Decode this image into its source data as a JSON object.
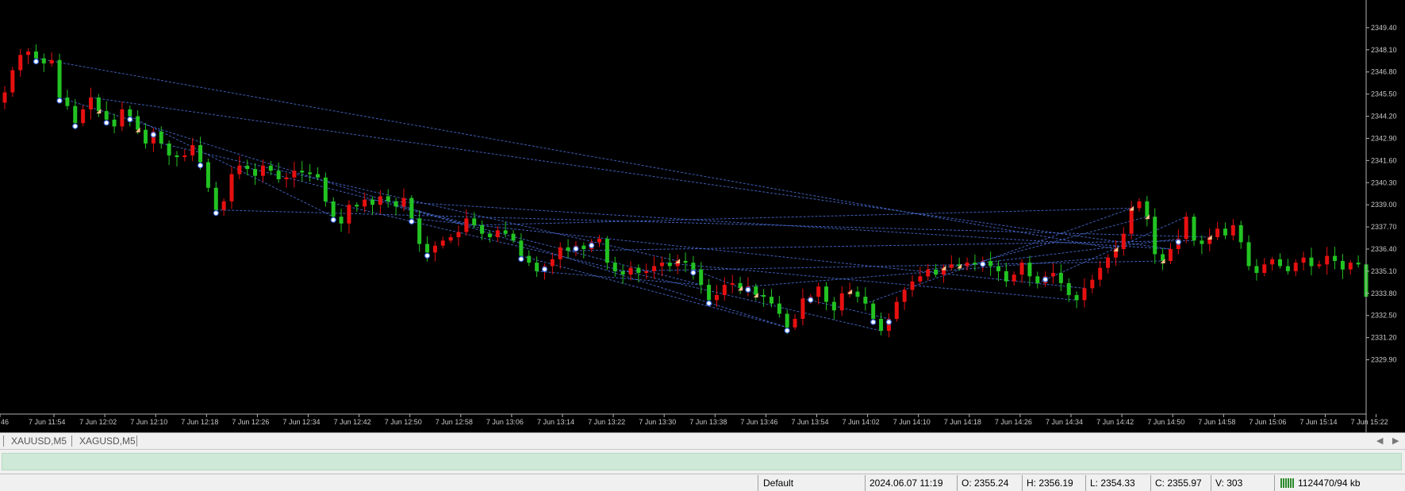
{
  "chart": {
    "price_ticks": [
      "2349.40",
      "2348.10",
      "2346.80",
      "2345.50",
      "2344.20",
      "2342.90",
      "2341.60",
      "2340.30",
      "2339.00",
      "2337.70",
      "2336.40",
      "2335.10",
      "2333.80",
      "2332.50",
      "2331.20",
      "2329.90"
    ],
    "time_ticks": [
      "46",
      "7 Jun 11:54",
      "7 Jun 12:02",
      "7 Jun 12:10",
      "7 Jun 12:18",
      "7 Jun 12:26",
      "7 Jun 12:34",
      "7 Jun 12:42",
      "7 Jun 12:50",
      "7 Jun 12:58",
      "7 Jun 13:06",
      "7 Jun 13:14",
      "7 Jun 13:22",
      "7 Jun 13:30",
      "7 Jun 13:38",
      "7 Jun 13:46",
      "7 Jun 13:54",
      "7 Jun 14:02",
      "7 Jun 14:10",
      "7 Jun 14:18",
      "7 Jun 14:26",
      "7 Jun 14:34",
      "7 Jun 14:42",
      "7 Jun 14:50",
      "7 Jun 14:58",
      "7 Jun 15:06",
      "7 Jun 15:14",
      "7 Jun 15:22"
    ],
    "y_max": 2350.0,
    "y_min": 2329.6,
    "colors": {
      "bull": "#22c322",
      "bear": "#e61010",
      "trend": "#4a6fd8",
      "axis_text": "#c8c8c8",
      "background": "#000000"
    },
    "closes": [
      2345.6,
      2346.9,
      2347.8,
      2348.0,
      2347.6,
      2347.3,
      2347.5,
      2345.3,
      2344.8,
      2343.8,
      2344.6,
      2345.3,
      2344.5,
      2344.0,
      2343.6,
      2344.6,
      2344.2,
      2343.4,
      2342.6,
      2343.3,
      2342.6,
      2341.9,
      2341.8,
      2341.9,
      2342.5,
      2341.5,
      2340.0,
      2338.7,
      2339.2,
      2340.8,
      2341.3,
      2341.1,
      2340.7,
      2341.3,
      2341.0,
      2340.5,
      2340.6,
      2341.0,
      2340.9,
      2340.8,
      2340.6,
      2339.2,
      2338.3,
      2337.9,
      2339.0,
      2338.9,
      2339.3,
      2339.0,
      2339.5,
      2339.2,
      2338.9,
      2339.4,
      2338.2,
      2336.7,
      2336.2,
      2336.6,
      2336.9,
      2337.1,
      2337.4,
      2338.2,
      2337.8,
      2337.3,
      2337.1,
      2337.5,
      2337.3,
      2336.9,
      2336.0,
      2335.6,
      2335.1,
      2335.4,
      2335.8,
      2336.5,
      2336.3,
      2336.6,
      2336.4,
      2336.8,
      2337.0,
      2335.6,
      2335.1,
      2334.9,
      2335.3,
      2335.0,
      2335.1,
      2335.4,
      2335.6,
      2335.4,
      2335.7,
      2335.6,
      2335.2,
      2334.3,
      2333.4,
      2333.7,
      2334.3,
      2334.4,
      2334.1,
      2334.2,
      2333.7,
      2333.6,
      2333.2,
      2332.6,
      2331.8,
      2332.3,
      2333.5,
      2333.6,
      2334.2,
      2333.3,
      2332.8,
      2333.8,
      2333.9,
      2333.6,
      2333.2,
      2332.3,
      2331.6,
      2332.3,
      2333.3,
      2334.0,
      2334.5,
      2334.8,
      2335.2,
      2334.9,
      2335.3,
      2335.5,
      2335.4,
      2335.6,
      2335.5,
      2335.7,
      2335.4,
      2335.1,
      2334.5,
      2334.9,
      2335.6,
      2334.8,
      2334.4,
      2334.8,
      2335.0,
      2334.4,
      2333.7,
      2333.4,
      2334.1,
      2334.6,
      2335.3,
      2335.9,
      2336.4,
      2337.3,
      2338.8,
      2339.2,
      2338.3,
      2336.1,
      2335.7,
      2336.4,
      2337.0,
      2338.3,
      2336.9,
      2336.7,
      2337.1,
      2337.6,
      2337.2,
      2337.8,
      2336.8,
      2335.4,
      2335.0,
      2335.5,
      2335.8,
      2335.4,
      2335.1,
      2335.6,
      2335.9,
      2335.4,
      2335.5,
      2336.0,
      2335.7,
      2335.2,
      2335.6,
      2335.5,
      2333.6
    ]
  },
  "tabs": [
    {
      "label": "XAUUSD,M5"
    },
    {
      "label": "XAGUSD,M5"
    }
  ],
  "progress": {
    "fraction": 0.999
  },
  "status": {
    "profile": "Default",
    "datetime": "2024.06.07 11:19",
    "open": "O: 2355.24",
    "high": "H: 2356.19",
    "low": "L: 2354.33",
    "close": "C: 2355.97",
    "volume": "V: 303",
    "traffic": "1124470/94 kb"
  }
}
